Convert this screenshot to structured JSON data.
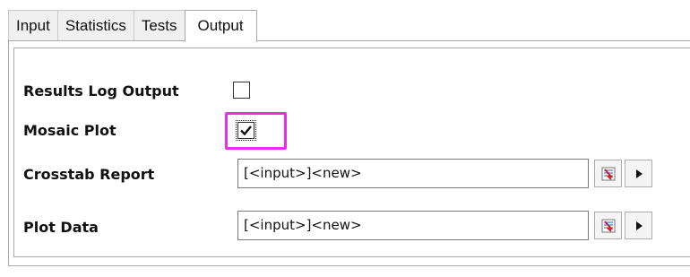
{
  "tabs": [
    {
      "label": "Input",
      "active": false
    },
    {
      "label": "Statistics",
      "active": false
    },
    {
      "label": "Tests",
      "active": false
    },
    {
      "label": "Output",
      "active": true
    }
  ],
  "options": {
    "results_log_output": {
      "label": "Results Log Output",
      "checked": false
    },
    "mosaic_plot": {
      "label": "Mosaic Plot",
      "checked": true,
      "highlight_color": "#ee2aee"
    },
    "crosstab_report": {
      "label": "Crosstab Report",
      "value": "[<input>]<new>",
      "browse_icon": "browse-icon",
      "menu_icon": "arrow-right-icon"
    },
    "plot_data": {
      "label": "Plot Data",
      "value": "[<input>]<new>",
      "browse_icon": "browse-icon",
      "menu_icon": "arrow-right-icon"
    }
  }
}
